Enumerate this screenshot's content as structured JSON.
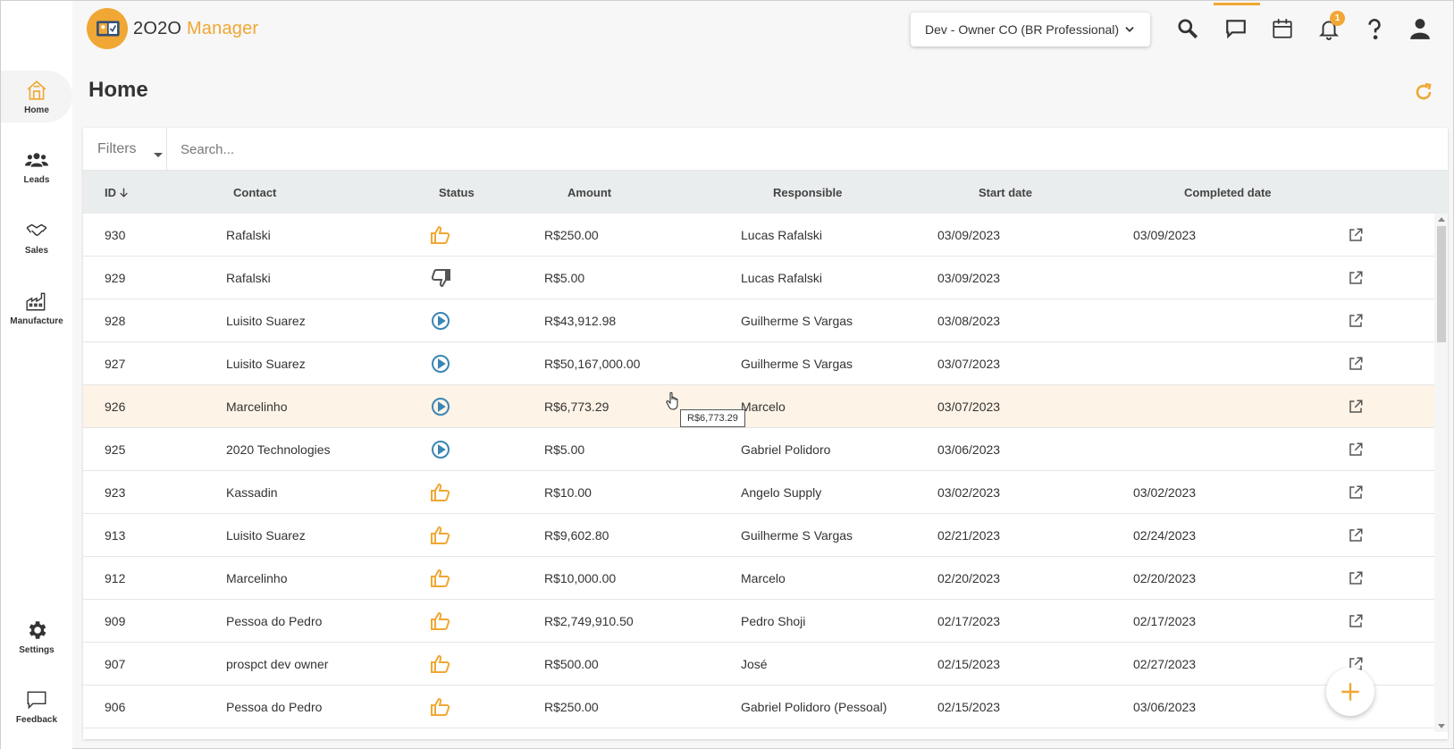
{
  "app": {
    "brand_prefix": "2O2O",
    "brand_suffix": "Manager",
    "account": "Dev - Owner CO (BR Professional)",
    "notification_count": "1"
  },
  "sidebar": {
    "items": [
      {
        "label": "Home",
        "icon": "home-icon"
      },
      {
        "label": "Leads",
        "icon": "people-icon"
      },
      {
        "label": "Sales",
        "icon": "handshake-icon"
      },
      {
        "label": "Manufacture",
        "icon": "factory-icon"
      },
      {
        "label": "Settings",
        "icon": "gear-icon"
      },
      {
        "label": "Feedback",
        "icon": "chat-icon"
      }
    ]
  },
  "page": {
    "title": "Home",
    "filters_label": "Filters",
    "search_placeholder": "Search..."
  },
  "table": {
    "columns": [
      "ID",
      "Contact",
      "Status",
      "Amount",
      "Responsible",
      "Start date",
      "Completed date"
    ],
    "rows": [
      {
        "id": "930",
        "contact": "Rafalski",
        "status": "won",
        "amount": "R$250.00",
        "responsible": "Lucas Rafalski",
        "start": "03/09/2023",
        "completed": "03/09/2023"
      },
      {
        "id": "929",
        "contact": "Rafalski",
        "status": "lost",
        "amount": "R$5.00",
        "responsible": "Lucas Rafalski",
        "start": "03/09/2023",
        "completed": ""
      },
      {
        "id": "928",
        "contact": "Luisito Suarez",
        "status": "in-progress",
        "amount": "R$43,912.98",
        "responsible": "Guilherme S Vargas",
        "start": "03/08/2023",
        "completed": ""
      },
      {
        "id": "927",
        "contact": "Luisito Suarez",
        "status": "in-progress",
        "amount": "R$50,167,000.00",
        "responsible": "Guilherme S Vargas",
        "start": "03/07/2023",
        "completed": ""
      },
      {
        "id": "926",
        "contact": "Marcelinho",
        "status": "in-progress",
        "amount": "R$6,773.29",
        "responsible": "Marcelo",
        "start": "03/07/2023",
        "completed": ""
      },
      {
        "id": "925",
        "contact": "2020 Technologies",
        "status": "in-progress",
        "amount": "R$5.00",
        "responsible": "Gabriel Polidoro",
        "start": "03/06/2023",
        "completed": ""
      },
      {
        "id": "923",
        "contact": "Kassadin",
        "status": "won",
        "amount": "R$10.00",
        "responsible": "Angelo Supply",
        "start": "03/02/2023",
        "completed": "03/02/2023"
      },
      {
        "id": "913",
        "contact": "Luisito Suarez",
        "status": "won",
        "amount": "R$9,602.80",
        "responsible": "Guilherme S Vargas",
        "start": "02/21/2023",
        "completed": "02/24/2023"
      },
      {
        "id": "912",
        "contact": "Marcelinho",
        "status": "won",
        "amount": "R$10,000.00",
        "responsible": "Marcelo",
        "start": "02/20/2023",
        "completed": "02/20/2023"
      },
      {
        "id": "909",
        "contact": "Pessoa do Pedro",
        "status": "won",
        "amount": "R$2,749,910.50",
        "responsible": "Pedro Shoji",
        "start": "02/17/2023",
        "completed": "02/17/2023"
      },
      {
        "id": "907",
        "contact": "prospct dev owner",
        "status": "won",
        "amount": "R$500.00",
        "responsible": "José",
        "start": "02/15/2023",
        "completed": "02/27/2023"
      },
      {
        "id": "906",
        "contact": "Pessoa do Pedro",
        "status": "won",
        "amount": "R$250.00",
        "responsible": "Gabriel Polidoro (Pessoal)",
        "start": "02/15/2023",
        "completed": "03/06/2023"
      }
    ]
  },
  "tooltip": {
    "text": "R$6,773.29"
  },
  "colors": {
    "accent": "#f0a733",
    "progress": "#3a86b4",
    "lost": "#555555"
  }
}
